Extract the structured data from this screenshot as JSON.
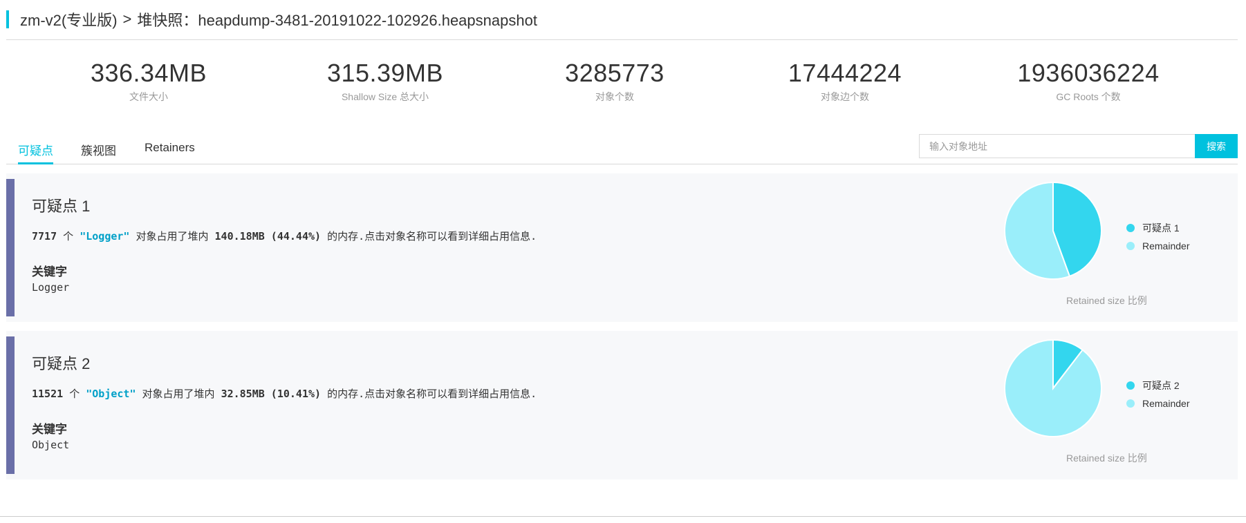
{
  "breadcrumb": {
    "app": "zm-v2(专业版)",
    "separator": ">",
    "page": "堆快照：heapdump-3481-20191022-102926.heapsnapshot"
  },
  "stats": [
    {
      "value": "336.34MB",
      "label": "文件大小"
    },
    {
      "value": "315.39MB",
      "label": "Shallow Size 总大小"
    },
    {
      "value": "3285773",
      "label": "对象个数"
    },
    {
      "value": "17444224",
      "label": "对象边个数"
    },
    {
      "value": "1936036224",
      "label": "GC Roots 个数"
    }
  ],
  "tabs": [
    {
      "label": "可疑点",
      "active": true
    },
    {
      "label": "簇视图",
      "active": false
    },
    {
      "label": "Retainers",
      "active": false
    }
  ],
  "search": {
    "placeholder": "输入对象地址",
    "button": "搜索"
  },
  "colors": {
    "accent": "#00c1de",
    "card_bar": "#6a6fa8",
    "pie_main": "#33d6ee",
    "pie_rest": "#9aeefa"
  },
  "suspects": [
    {
      "title": "可疑点 1",
      "count": "7717",
      "count_unit": "个",
      "class_name": "\"Logger\"",
      "middle": "对象占用了堆内",
      "size": "140.18MB (44.44%)",
      "suffix": "的内存.点击对象名称可以看到详细占用信息.",
      "keyword_title": "关键字",
      "keyword": "Logger",
      "fraction": 0.4444,
      "legend_main": "可疑点 1",
      "legend_rest": "Remainder",
      "caption": "Retained size 比例"
    },
    {
      "title": "可疑点 2",
      "count": "11521",
      "count_unit": "个",
      "class_name": "\"Object\"",
      "middle": "对象占用了堆内",
      "size": "32.85MB (10.41%)",
      "suffix": "的内存.点击对象名称可以看到详细占用信息.",
      "keyword_title": "关键字",
      "keyword": "Object",
      "fraction": 0.1041,
      "legend_main": "可疑点 2",
      "legend_rest": "Remainder",
      "caption": "Retained size 比例"
    }
  ]
}
